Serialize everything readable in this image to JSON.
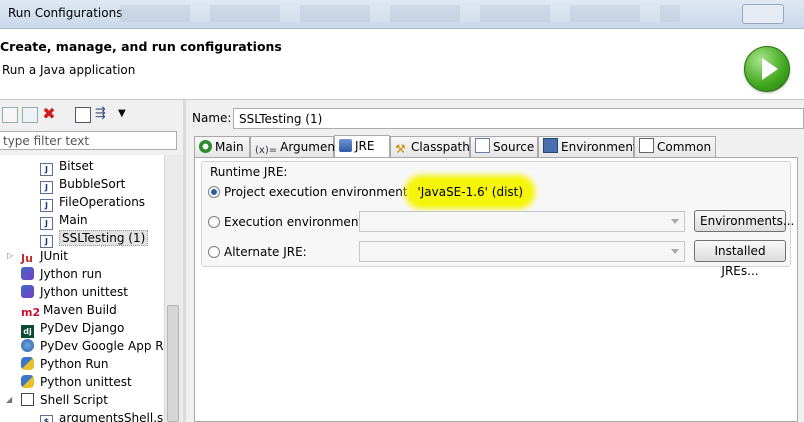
{
  "window": {
    "title": "Run Configurations"
  },
  "header": {
    "title": "Create, manage, and run configurations",
    "subtitle": "Run a Java application",
    "run_icon": "run-play-icon"
  },
  "left_panel": {
    "filter_placeholder": "type filter text",
    "toolbar_icons": [
      "new-config-icon",
      "duplicate-icon",
      "delete-icon",
      "collapse-all-icon",
      "filter-icon",
      "view-menu-icon"
    ],
    "tree": [
      {
        "label": "Bitset",
        "icon": "java-app-icon"
      },
      {
        "label": "BubbleSort",
        "icon": "java-app-icon"
      },
      {
        "label": "FileOperations",
        "icon": "java-app-icon"
      },
      {
        "label": "Main",
        "icon": "java-app-icon"
      },
      {
        "label": "SSLTesting (1)",
        "icon": "java-app-icon",
        "selected": true
      },
      {
        "label": "JUnit",
        "icon": "junit-icon"
      },
      {
        "label": "Jython run",
        "icon": "jython-icon"
      },
      {
        "label": "Jython unittest",
        "icon": "jython-icon"
      },
      {
        "label": "Maven Build",
        "icon": "maven-icon"
      },
      {
        "label": "PyDev Django",
        "icon": "django-icon"
      },
      {
        "label": "PyDev Google App Run",
        "icon": "google-app-icon"
      },
      {
        "label": "Python Run",
        "icon": "python-icon"
      },
      {
        "label": "Python unittest",
        "icon": "python-icon"
      },
      {
        "label": "Shell Script",
        "icon": "shell-icon"
      },
      {
        "label": "argumentsShell.sh",
        "icon": "shell-file-icon"
      }
    ]
  },
  "right_panel": {
    "name_label": "Name:",
    "name_value": "SSLTesting (1)",
    "tabs": [
      {
        "label": "Main",
        "icon": "main-tab-icon"
      },
      {
        "label": "Arguments",
        "icon": "arguments-tab-icon",
        "glyph": "(x)="
      },
      {
        "label": "JRE",
        "icon": "jre-tab-icon",
        "active": true
      },
      {
        "label": "Classpath",
        "icon": "classpath-tab-icon"
      },
      {
        "label": "Source",
        "icon": "source-tab-icon"
      },
      {
        "label": "Environment",
        "icon": "environment-tab-icon"
      },
      {
        "label": "Common",
        "icon": "common-tab-icon"
      }
    ],
    "jre": {
      "group_label": "Runtime JRE:",
      "project_env_label": "Project execution environment",
      "project_env_value": "'JavaSE-1.6' (dist)",
      "exec_env_label": "Execution environment:",
      "exec_env_button": "Environments...",
      "alt_jre_label": "Alternate JRE:",
      "alt_jre_button": "Installed JREs..."
    }
  }
}
